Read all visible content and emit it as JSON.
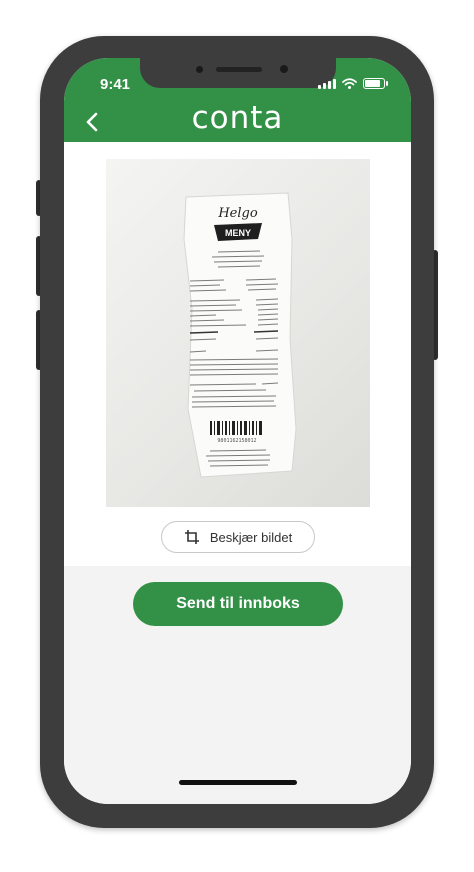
{
  "status_bar": {
    "time": "9:41"
  },
  "header": {
    "brand": "conta"
  },
  "receipt": {
    "brand_script": "Helgo",
    "brand_badge": "MENY",
    "barcode_number": "9801162158012"
  },
  "actions": {
    "crop_label": "Beskjær bildet",
    "send_label": "Send til innboks"
  },
  "colors": {
    "brand_green": "#339147"
  },
  "icons": [
    "chevron-left-icon",
    "crop-icon",
    "signal-icon",
    "wifi-icon",
    "battery-icon"
  ]
}
